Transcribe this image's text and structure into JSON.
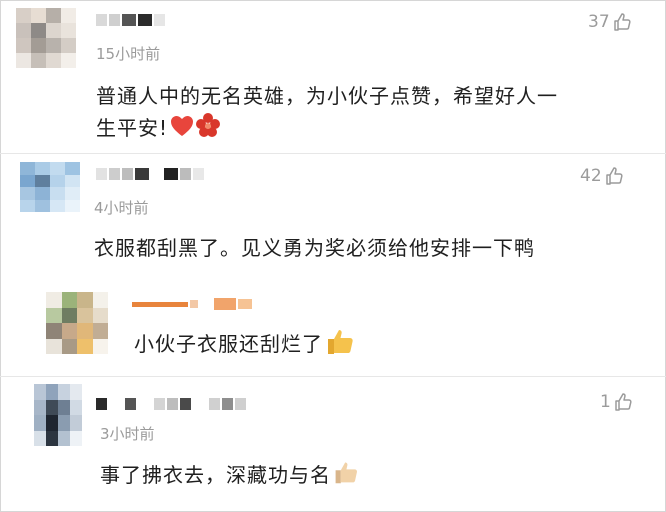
{
  "comments": [
    {
      "time": "15小时前",
      "text_line1": "普通人中的无名英雄，为小伙子点赞，希望好人一",
      "text_line2": "生平安!",
      "likes": "37",
      "emoji": [
        "red-heart",
        "red-flower"
      ]
    },
    {
      "time": "4小时前",
      "text": "衣服都刮黑了。见义勇为奖必须给他安排一下鸭",
      "likes": "42"
    },
    {
      "text": "小伙子衣服还刮烂了",
      "emoji": [
        "thumbs-up"
      ]
    },
    {
      "time": "3小时前",
      "text": "事了拂衣去，深藏功与名",
      "likes": "1",
      "emoji": [
        "thumbs-up"
      ]
    }
  ],
  "colors": {
    "text": "#1f1f1f",
    "meta": "#9b9b9b",
    "divider": "#e7e7e7",
    "heart": "#e8453c",
    "thumb": "#f2c14e"
  },
  "icons": {
    "like": "thumbs-up-outline-icon"
  }
}
